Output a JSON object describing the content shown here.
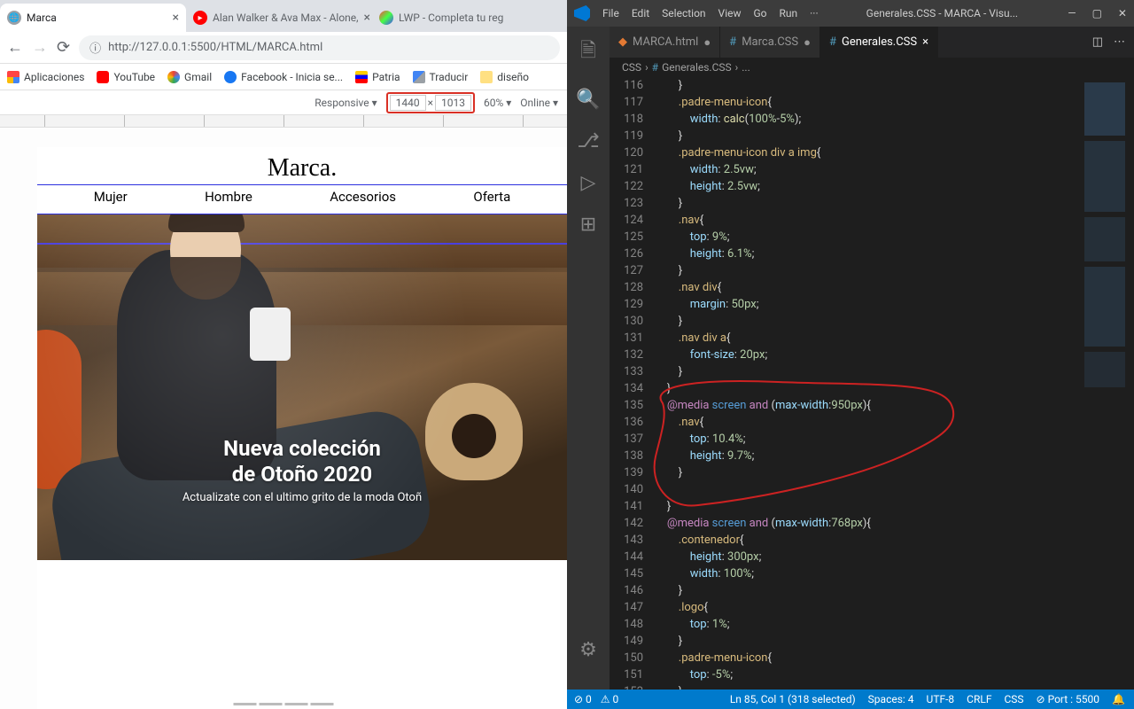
{
  "chrome": {
    "tabs": [
      {
        "title": "Marca",
        "active": true
      },
      {
        "title": "Alan Walker & Ava Max - Alone,",
        "active": false
      },
      {
        "title": "LWP - Completa tu reg",
        "active": false
      }
    ],
    "url": "http://127.0.0.1:5500/HTML/MARCA.html",
    "bookmarks": [
      "Aplicaciones",
      "YouTube",
      "Gmail",
      "Facebook - Inicia se...",
      "Patria",
      "Traducir",
      "diseño"
    ],
    "devtoolbar": {
      "mode": "Responsive ▾",
      "width": "1440",
      "height": "1013",
      "times": "×",
      "zoom": "60% ▾",
      "throttle": "Online ▾"
    },
    "page": {
      "brand": "Marca.",
      "nav": [
        "Mujer",
        "Hombre",
        "Accesorios",
        "Oferta"
      ],
      "hero_title_1": "Nueva colección",
      "hero_title_2": "de Otoño 2020",
      "hero_sub": "Actualizate con el ultimo grito de la moda Otoñ"
    }
  },
  "vscode": {
    "menu": [
      "File",
      "Edit",
      "Selection",
      "View",
      "Go",
      "Run",
      "···"
    ],
    "window_title": "Generales.CSS - MARCA - Visu...",
    "editor_tabs": [
      {
        "name": "MARCA.html",
        "active": false,
        "kind": "html",
        "dirty": true
      },
      {
        "name": "Marca.CSS",
        "active": false,
        "kind": "css",
        "dirty": true
      },
      {
        "name": "Generales.CSS",
        "active": true,
        "kind": "css",
        "dirty": false
      }
    ],
    "breadcrumb": [
      "CSS",
      "Generales.CSS",
      "..."
    ],
    "first_line": 116,
    "code": [
      [
        [
          "        ",
          "punc"
        ],
        [
          "}",
          "punc"
        ]
      ],
      [
        [
          "        ",
          "punc"
        ],
        [
          ".padre-menu-icon",
          "sel"
        ],
        [
          "{",
          "punc"
        ]
      ],
      [
        [
          "            ",
          "punc"
        ],
        [
          "width",
          "prop"
        ],
        [
          ": ",
          "punc"
        ],
        [
          "calc",
          "func"
        ],
        [
          "(",
          "punc"
        ],
        [
          "100%",
          "num"
        ],
        [
          "-",
          "punc"
        ],
        [
          "5%",
          "num"
        ],
        [
          ")",
          "punc"
        ],
        [
          ";",
          "punc"
        ]
      ],
      [
        [
          "        ",
          "punc"
        ],
        [
          "}",
          "punc"
        ]
      ],
      [
        [
          "        ",
          "punc"
        ],
        [
          ".padre-menu-icon div a img",
          "sel"
        ],
        [
          "{",
          "punc"
        ]
      ],
      [
        [
          "            ",
          "punc"
        ],
        [
          "width",
          "prop"
        ],
        [
          ": ",
          "punc"
        ],
        [
          "2.5vw",
          "num"
        ],
        [
          ";",
          "punc"
        ]
      ],
      [
        [
          "            ",
          "punc"
        ],
        [
          "height",
          "prop"
        ],
        [
          ": ",
          "punc"
        ],
        [
          "2.5vw",
          "num"
        ],
        [
          ";",
          "punc"
        ]
      ],
      [
        [
          "        ",
          "punc"
        ],
        [
          "}",
          "punc"
        ]
      ],
      [
        [
          "        ",
          "punc"
        ],
        [
          ".nav",
          "sel"
        ],
        [
          "{",
          "punc"
        ]
      ],
      [
        [
          "            ",
          "punc"
        ],
        [
          "top",
          "prop"
        ],
        [
          ": ",
          "punc"
        ],
        [
          "9%",
          "num"
        ],
        [
          ";",
          "punc"
        ]
      ],
      [
        [
          "            ",
          "punc"
        ],
        [
          "height",
          "prop"
        ],
        [
          ": ",
          "punc"
        ],
        [
          "6.1%",
          "num"
        ],
        [
          ";",
          "punc"
        ]
      ],
      [
        [
          "        ",
          "punc"
        ],
        [
          "}",
          "punc"
        ]
      ],
      [
        [
          "        ",
          "punc"
        ],
        [
          ".nav div",
          "sel"
        ],
        [
          "{",
          "punc"
        ]
      ],
      [
        [
          "            ",
          "punc"
        ],
        [
          "margin",
          "prop"
        ],
        [
          ": ",
          "punc"
        ],
        [
          "50px",
          "num"
        ],
        [
          ";",
          "punc"
        ]
      ],
      [
        [
          "        ",
          "punc"
        ],
        [
          "}",
          "punc"
        ]
      ],
      [
        [
          "        ",
          "punc"
        ],
        [
          ".nav div a",
          "sel"
        ],
        [
          "{",
          "punc"
        ]
      ],
      [
        [
          "            ",
          "punc"
        ],
        [
          "font-size",
          "prop"
        ],
        [
          ": ",
          "punc"
        ],
        [
          "20px",
          "num"
        ],
        [
          ";",
          "punc"
        ]
      ],
      [
        [
          "        ",
          "punc"
        ],
        [
          "}",
          "punc"
        ]
      ],
      [
        [
          "    ",
          "punc"
        ],
        [
          "}",
          "punc"
        ]
      ],
      [
        [
          "    ",
          "punc"
        ],
        [
          "@media",
          "kw"
        ],
        [
          " ",
          "punc"
        ],
        [
          "screen",
          "kw2"
        ],
        [
          " ",
          "punc"
        ],
        [
          "and",
          "kw"
        ],
        [
          " (",
          "punc"
        ],
        [
          "max-width",
          "prop"
        ],
        [
          ":",
          "punc"
        ],
        [
          "950px",
          "num"
        ],
        [
          "){",
          "punc"
        ]
      ],
      [
        [
          "        ",
          "punc"
        ],
        [
          ".nav",
          "sel"
        ],
        [
          "{",
          "punc"
        ]
      ],
      [
        [
          "            ",
          "punc"
        ],
        [
          "top",
          "prop"
        ],
        [
          ": ",
          "punc"
        ],
        [
          "10.4%",
          "num"
        ],
        [
          ";",
          "punc"
        ]
      ],
      [
        [
          "            ",
          "punc"
        ],
        [
          "height",
          "prop"
        ],
        [
          ": ",
          "punc"
        ],
        [
          "9.7%",
          "num"
        ],
        [
          ";",
          "punc"
        ]
      ],
      [
        [
          "        ",
          "punc"
        ],
        [
          "}",
          "punc"
        ]
      ],
      [
        [
          "",
          "punc"
        ]
      ],
      [
        [
          "    ",
          "punc"
        ],
        [
          "}",
          "punc"
        ]
      ],
      [
        [
          "    ",
          "punc"
        ],
        [
          "@media",
          "kw"
        ],
        [
          " ",
          "punc"
        ],
        [
          "screen",
          "kw2"
        ],
        [
          " ",
          "punc"
        ],
        [
          "and",
          "kw"
        ],
        [
          " (",
          "punc"
        ],
        [
          "max-width",
          "prop"
        ],
        [
          ":",
          "punc"
        ],
        [
          "768px",
          "num"
        ],
        [
          "){",
          "punc"
        ]
      ],
      [
        [
          "        ",
          "punc"
        ],
        [
          ".contenedor",
          "sel"
        ],
        [
          "{",
          "punc"
        ]
      ],
      [
        [
          "            ",
          "punc"
        ],
        [
          "height",
          "prop"
        ],
        [
          ": ",
          "punc"
        ],
        [
          "300px",
          "num"
        ],
        [
          ";",
          "punc"
        ]
      ],
      [
        [
          "            ",
          "punc"
        ],
        [
          "width",
          "prop"
        ],
        [
          ": ",
          "punc"
        ],
        [
          "100%",
          "num"
        ],
        [
          ";",
          "punc"
        ]
      ],
      [
        [
          "        ",
          "punc"
        ],
        [
          "}",
          "punc"
        ]
      ],
      [
        [
          "        ",
          "punc"
        ],
        [
          ".logo",
          "sel"
        ],
        [
          "{",
          "punc"
        ]
      ],
      [
        [
          "            ",
          "punc"
        ],
        [
          "top",
          "prop"
        ],
        [
          ": ",
          "punc"
        ],
        [
          "1%",
          "num"
        ],
        [
          ";",
          "punc"
        ]
      ],
      [
        [
          "        ",
          "punc"
        ],
        [
          "}",
          "punc"
        ]
      ],
      [
        [
          "        ",
          "punc"
        ],
        [
          ".padre-menu-icon",
          "sel"
        ],
        [
          "{",
          "punc"
        ]
      ],
      [
        [
          "            ",
          "punc"
        ],
        [
          "top",
          "prop"
        ],
        [
          ": ",
          "punc"
        ],
        [
          "-5%",
          "num"
        ],
        [
          ";",
          "punc"
        ]
      ],
      [
        [
          "        ",
          "punc"
        ],
        [
          "}",
          "punc"
        ]
      ]
    ],
    "status": {
      "left": [
        "⊘ 0",
        "⚠ 0"
      ],
      "right": [
        "Ln 85, Col 1 (318 selected)",
        "Spaces: 4",
        "UTF-8",
        "CRLF",
        "CSS",
        "⊘ Port : 5500",
        "🔔"
      ]
    }
  }
}
